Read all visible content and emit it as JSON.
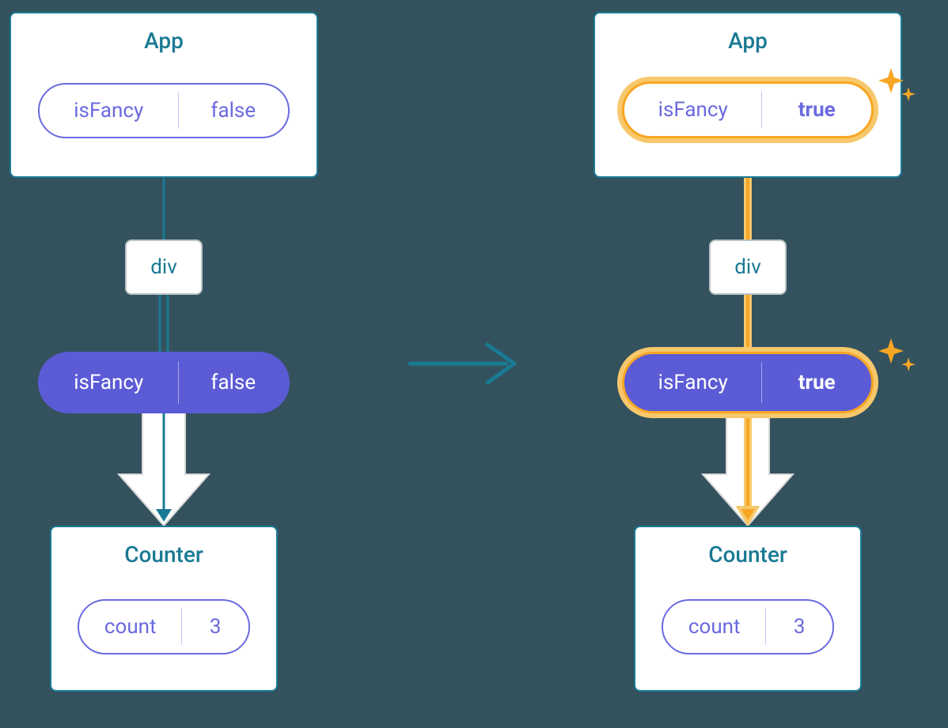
{
  "left": {
    "app": {
      "title": "App",
      "state": {
        "key": "isFancy",
        "value": "false"
      }
    },
    "div": {
      "label": "div"
    },
    "prop": {
      "key": "isFancy",
      "value": "false"
    },
    "counter": {
      "title": "Counter",
      "state": {
        "key": "count",
        "value": "3"
      }
    }
  },
  "right": {
    "app": {
      "title": "App",
      "state": {
        "key": "isFancy",
        "value": "true"
      }
    },
    "div": {
      "label": "div"
    },
    "prop": {
      "key": "isFancy",
      "value": "true"
    },
    "counter": {
      "title": "Counter",
      "state": {
        "key": "count",
        "value": "3"
      }
    }
  },
  "colors": {
    "teal": "#1a7a94",
    "purple": "#6a6ae0",
    "purpleSolid": "#5b5bd6",
    "orange": "#f7a623",
    "orangeGlow": "#f7c86b",
    "bg": "#33525e"
  }
}
